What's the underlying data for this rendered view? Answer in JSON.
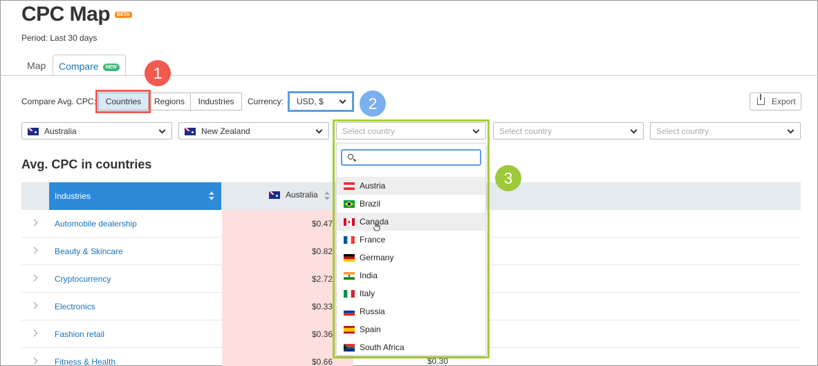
{
  "header": {
    "title": "CPC Map",
    "beta": "BETA",
    "period": "Period: Last 30 days"
  },
  "tabs": {
    "map": "Map",
    "compare": "Compare",
    "compare_badge": "NEW"
  },
  "controls": {
    "compare_label": "Compare Avg. CPC:",
    "segments": {
      "countries": "Countries",
      "regions": "Regions",
      "industries": "Industries"
    },
    "currency_label": "Currency:",
    "currency_value": "USD, $",
    "export": "Export"
  },
  "country_selects": {
    "first": "Australia",
    "second": "New Zealand",
    "third_placeholder": "Select country",
    "fourth_placeholder": "Select country",
    "fifth_placeholder": "Select country"
  },
  "annotations": {
    "one": "1",
    "two": "2",
    "three": "3"
  },
  "dropdown": {
    "search_placeholder": "",
    "countries": [
      "Austria",
      "Brazil",
      "Canada",
      "France",
      "Germany",
      "India",
      "Italy",
      "Russia",
      "Spain",
      "South Africa"
    ]
  },
  "table": {
    "heading": "Avg. CPC in countries",
    "col_industries": "Industries",
    "col_australia": "Australia",
    "rows": [
      {
        "name": "Automobile dealership",
        "au": "$0.47"
      },
      {
        "name": "Beauty & Skincare",
        "au": "$0.82"
      },
      {
        "name": "Cryptocurrency",
        "au": "$2.72"
      },
      {
        "name": "Electronics",
        "au": "$0.33"
      },
      {
        "name": "Fashion retail",
        "au": "$0.36"
      },
      {
        "name": "Fitness & Health",
        "au": "$0.66",
        "nz": "$0.30"
      }
    ]
  },
  "colors": {
    "accent": "#2d8ad9",
    "annotation_red": "#f25a4f",
    "annotation_blue": "#5b9ce6",
    "annotation_green": "#a9cf3a",
    "highlight_cell": "#fde0de"
  }
}
